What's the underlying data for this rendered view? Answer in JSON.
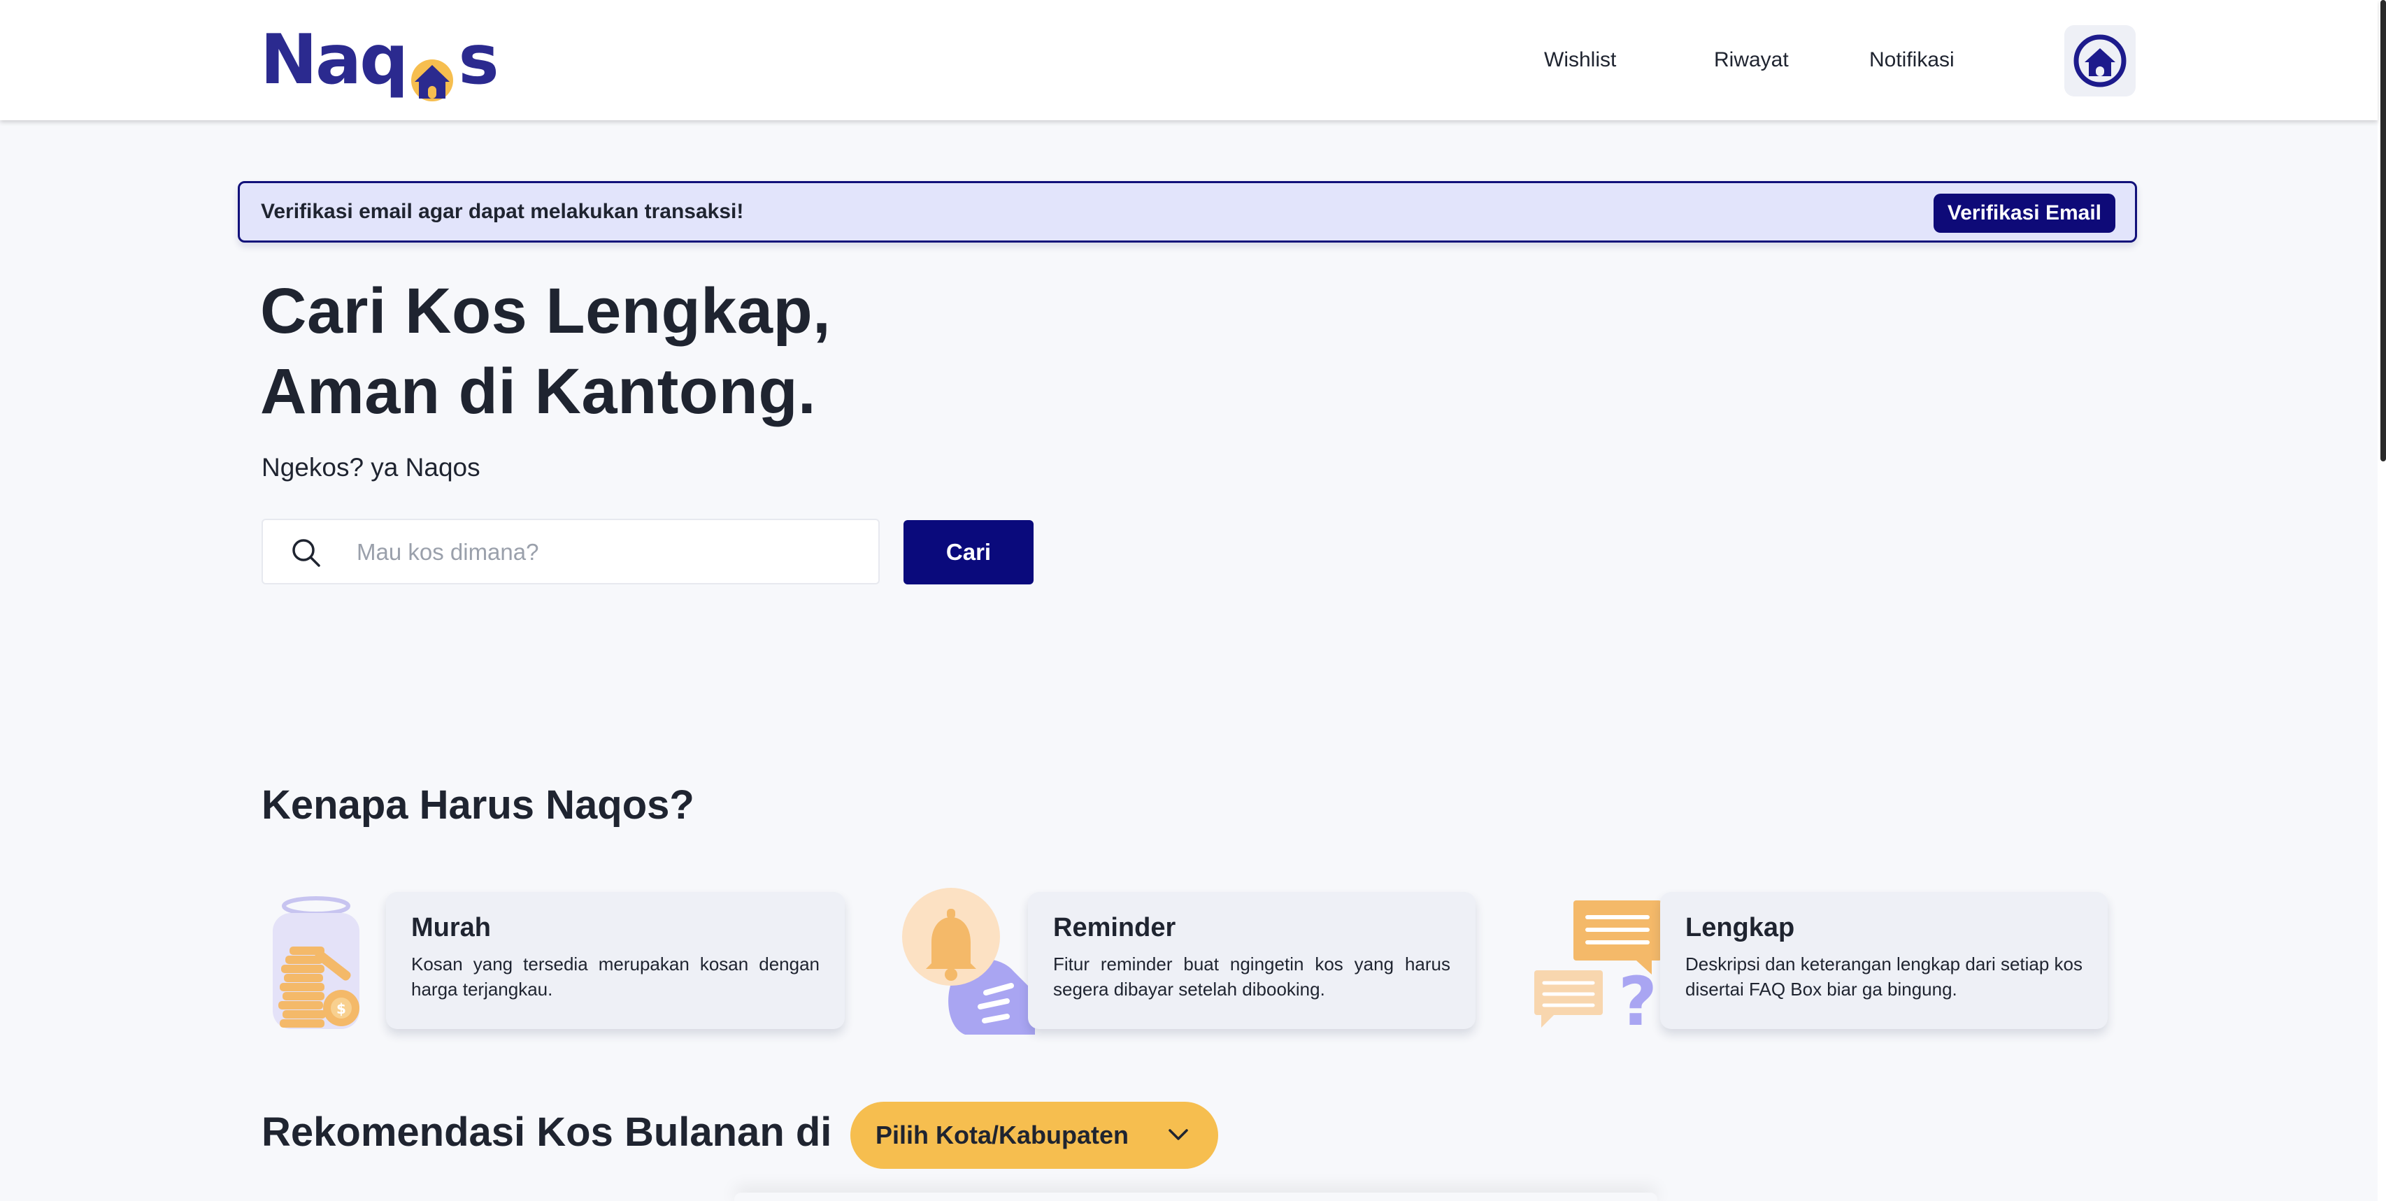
{
  "brand": {
    "logo_text_left": "Naq",
    "logo_text_right": "s",
    "colors": {
      "primary": "#2b2a8f",
      "accent": "#f6be4f",
      "navy": "#0a0a7c"
    }
  },
  "nav": {
    "wishlist": "Wishlist",
    "riwayat": "Riwayat",
    "notifikasi": "Notifikasi",
    "profile_icon": "home-circle-icon"
  },
  "banner": {
    "text": "Verifikasi email agar dapat melakukan transaksi!",
    "button": "Verifikasi Email"
  },
  "hero": {
    "title_line1": "Cari Kos Lengkap,",
    "title_line2": "Aman di Kantong.",
    "subtitle": "Ngekos? ya Naqos",
    "search_placeholder": "Mau kos dimana?",
    "search_value": "",
    "search_button": "Cari"
  },
  "why": {
    "title": "Kenapa Harus Naqos?",
    "features": [
      {
        "title": "Murah",
        "desc": "Kosan yang tersedia merupakan kosan dengan harga terjangkau.",
        "icon": "coin-jar-icon"
      },
      {
        "title": "Reminder",
        "desc": "Fitur reminder buat ngingetin kos yang harus segera dibayar setelah dibooking.",
        "icon": "bell-icon"
      },
      {
        "title": "Lengkap",
        "desc": "Deskripsi dan keterangan lengkap dari setiap kos disertai FAQ Box biar ga bingung.",
        "icon": "chat-question-icon"
      }
    ]
  },
  "rekomendasi": {
    "title": "Rekomendasi Kos Bulanan di",
    "select_label": "Pilih Kota/Kabupaten"
  }
}
